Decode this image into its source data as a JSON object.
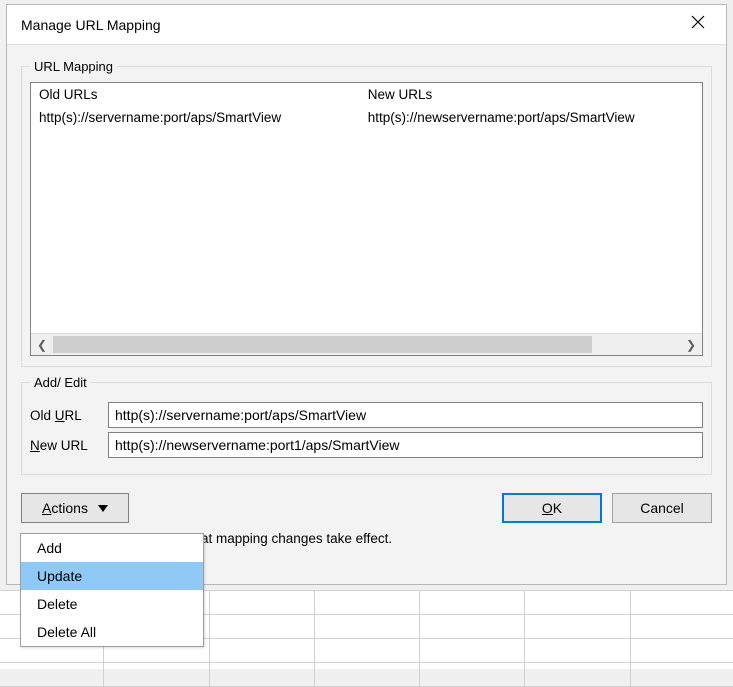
{
  "title": "Manage URL Mapping",
  "group_main": {
    "legend": "URL Mapping"
  },
  "table": {
    "headers": {
      "old": "Old URLs",
      "new": "New URLs"
    },
    "rows": [
      {
        "old": "http(s)://servername:port/aps/SmartView",
        "new": "http(s)://newservername:port/aps/SmartView"
      }
    ]
  },
  "group_edit": {
    "legend": "Add/ Edit"
  },
  "form": {
    "old_label_pre": "Old ",
    "old_label_ul": "U",
    "old_label_post": "RL",
    "old_value": "http(s)://servername:port/aps/SmartView",
    "new_label_pre": "",
    "new_label_ul": "N",
    "new_label_post": "ew URL",
    "new_value": "http(s)://newservername:port1/aps/SmartView"
  },
  "actions_btn_ul": "A",
  "actions_btn_rest": "ctions",
  "ok_ul": "O",
  "ok_rest": "K",
  "cancel_label": "Cancel",
  "hint_visible_fragment": "at mapping changes take effect.",
  "menu": {
    "items": [
      "Add",
      "Update",
      "Delete",
      "Delete All"
    ],
    "highlighted_index": 1
  }
}
